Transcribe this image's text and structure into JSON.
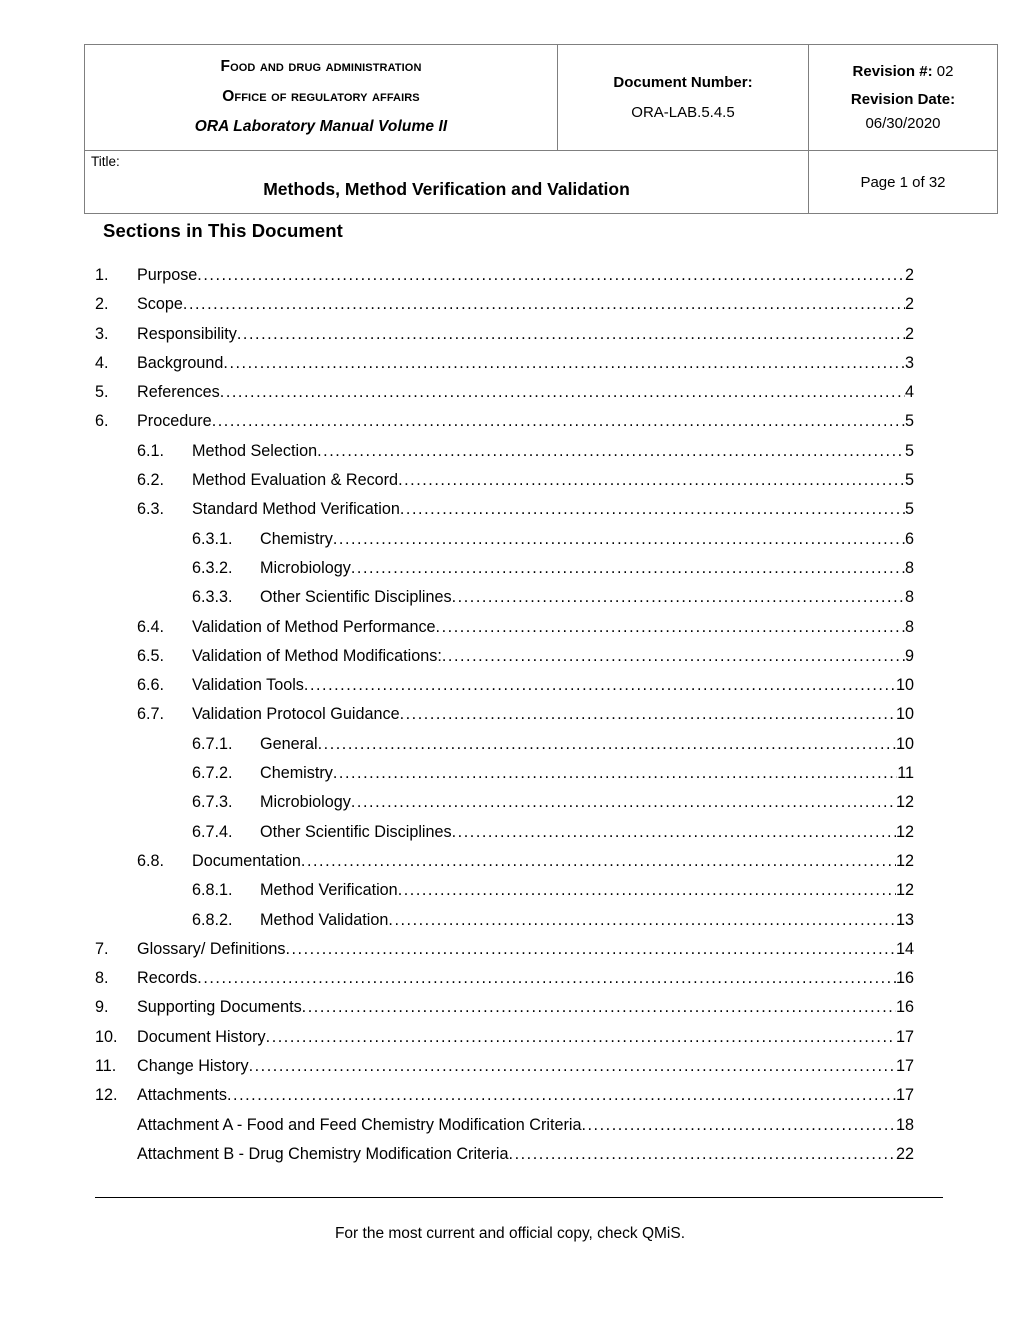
{
  "header": {
    "org_line1": "Food and Drug Administration",
    "org_line2": "Office of Regulatory Affairs",
    "org_line3": "ORA Laboratory Manual Volume II",
    "doc_number_label": "Document Number:",
    "doc_number_value": "ORA-LAB.5.4.5",
    "revision_number_label": "Revision #:",
    "revision_number_value": "02",
    "revision_date_label": "Revision Date:",
    "revision_date_value": "06/30/2020",
    "title_label": "Title:",
    "title_text": "Methods, Method Verification and Validation",
    "page_indicator": "Page 1 of 32"
  },
  "body": {
    "sections_heading": "Sections in This Document"
  },
  "toc": [
    {
      "level": 1,
      "number": "1.",
      "label": "Purpose",
      "page": "2"
    },
    {
      "level": 1,
      "number": "2.",
      "label": "Scope",
      "page": "2"
    },
    {
      "level": 1,
      "number": "3.",
      "label": "Responsibility",
      "page": "2"
    },
    {
      "level": 1,
      "number": "4.",
      "label": "Background",
      "page": "3"
    },
    {
      "level": 1,
      "number": "5.",
      "label": "References",
      "page": "4"
    },
    {
      "level": 1,
      "number": "6.",
      "label": "Procedure",
      "page": "5"
    },
    {
      "level": 2,
      "number": "6.1.",
      "label": "Method Selection",
      "page": "5"
    },
    {
      "level": 2,
      "number": "6.2.",
      "label": "Method Evaluation & Record",
      "page": "5"
    },
    {
      "level": 2,
      "number": "6.3.",
      "label": "Standard Method Verification",
      "page": "5"
    },
    {
      "level": 3,
      "number": "6.3.1.",
      "label": "Chemistry",
      "page": "6"
    },
    {
      "level": 3,
      "number": "6.3.2.",
      "label": "Microbiology",
      "page": "8"
    },
    {
      "level": 3,
      "number": "6.3.3.",
      "label": "Other Scientific Disciplines",
      "page": "8"
    },
    {
      "level": 2,
      "number": "6.4.",
      "label": "Validation of Method Performance",
      "page": "8"
    },
    {
      "level": 2,
      "number": "6.5.",
      "label": "Validation of Method Modifications:",
      "page": "9"
    },
    {
      "level": 2,
      "number": "6.6.",
      "label": "Validation Tools",
      "page": "10"
    },
    {
      "level": 2,
      "number": "6.7.",
      "label": "Validation Protocol Guidance",
      "page": "10"
    },
    {
      "level": 3,
      "number": "6.7.1.",
      "label": "General",
      "page": "10"
    },
    {
      "level": 3,
      "number": "6.7.2.",
      "label": "Chemistry",
      "page": "11"
    },
    {
      "level": 3,
      "number": "6.7.3.",
      "label": "Microbiology",
      "page": "12"
    },
    {
      "level": 3,
      "number": "6.7.4.",
      "label": "Other Scientific Disciplines",
      "page": "12"
    },
    {
      "level": 2,
      "number": "6.8.",
      "label": "Documentation",
      "page": "12"
    },
    {
      "level": 3,
      "number": "6.8.1.",
      "label": "Method Verification",
      "page": "12"
    },
    {
      "level": 3,
      "number": "6.8.2.",
      "label": "Method Validation",
      "page": "13"
    },
    {
      "level": 1,
      "number": "7.",
      "label": "Glossary/ Definitions",
      "page": "14"
    },
    {
      "level": 1,
      "number": "8.",
      "label": "Records",
      "page": "16"
    },
    {
      "level": 1,
      "number": "9.",
      "label": "Supporting Documents",
      "page": "16"
    },
    {
      "level": 1,
      "number": "10.",
      "label": "Document History",
      "page": "17"
    },
    {
      "level": 1,
      "number": "11.",
      "label": "Change History",
      "page": "17"
    },
    {
      "level": 1,
      "number": "12.",
      "label": "Attachments",
      "page": "17"
    },
    {
      "level": 4,
      "number": "",
      "label": "Attachment A - Food and Feed Chemistry Modification Criteria",
      "page": "18"
    },
    {
      "level": 4,
      "number": "",
      "label": "Attachment B - Drug Chemistry Modification Criteria",
      "page": "22"
    }
  ],
  "footer": {
    "text": "For the most current and official copy, check QMiS."
  }
}
